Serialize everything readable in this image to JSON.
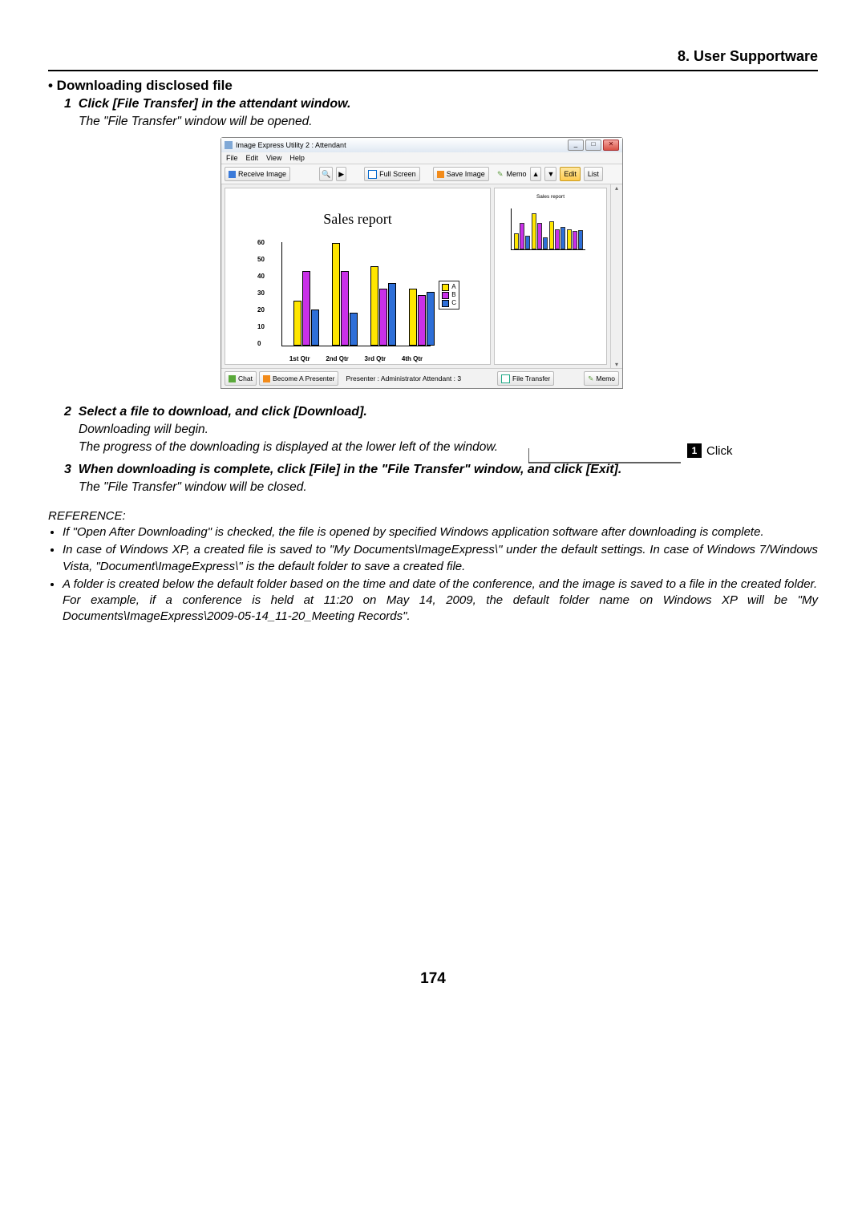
{
  "header": {
    "chapter": "8. User Supportware"
  },
  "section": {
    "title": "• Downloading disclosed file"
  },
  "steps": {
    "s1": {
      "num": "1",
      "text": "Click [File Transfer] in the attendant window.",
      "desc": "The \"File Transfer\" window will be opened."
    },
    "s2": {
      "num": "2",
      "text": "Select a file to download, and click [Download].",
      "desc1": "Downloading will begin.",
      "desc2": "The progress of the downloading is displayed at the lower left of the window."
    },
    "s3": {
      "num": "3",
      "text": "When downloading is complete, click [File] in the \"File Transfer\" window, and click [Exit].",
      "desc": "The \"File Transfer\" window will be closed."
    }
  },
  "reference": {
    "head": "REFERENCE:",
    "items": [
      "If \"Open After Downloading\" is checked, the file is opened by specified Windows application software after downloading is complete.",
      "In case of Windows XP, a created file is saved to \"My Documents\\ImageExpress\\\" under the default settings. In case of Windows 7/Windows Vista, \"Document\\ImageExpress\\\" is the default folder to save a created file.",
      "A folder is created below the default folder based on the time and date of the conference, and the image is saved to a file in the created folder.\nFor example, if a conference is held at 11:20 on May 14, 2009, the default folder name on Windows XP will be \"My Documents\\ImageExpress\\2009-05-14_11-20_Meeting Records\"."
    ]
  },
  "page_number": "174",
  "callout": {
    "label": "Click",
    "badge": "1"
  },
  "app_window": {
    "title": "Image Express Utility 2 : Attendant",
    "menus": [
      "File",
      "Edit",
      "View",
      "Help"
    ],
    "toolbar": {
      "receive": "Receive Image",
      "fullscreen": "Full Screen",
      "saveimage": "Save Image"
    },
    "side_toolbar": {
      "memo": "Memo",
      "edit": "Edit",
      "list": "List"
    },
    "status": {
      "chat": "Chat",
      "become": "Become A Presenter",
      "info": "Presenter : Administrator   Attendant : 3",
      "filetransfer": "File Transfer",
      "memo": "Memo"
    }
  },
  "chart_data": {
    "type": "bar",
    "title": "Sales report",
    "xlabel": "",
    "ylabel": "",
    "categories": [
      "1st Qtr",
      "2nd Qtr",
      "3rd Qtr",
      "4th Qtr"
    ],
    "series": [
      {
        "name": "A",
        "color": "#ffe600",
        "values": [
          25,
          58,
          45,
          32
        ]
      },
      {
        "name": "B",
        "color": "#c930e8",
        "values": [
          42,
          42,
          32,
          28
        ]
      },
      {
        "name": "C",
        "color": "#2e6fd8",
        "values": [
          20,
          18,
          35,
          30
        ]
      }
    ],
    "y_ticks": [
      0,
      10,
      20,
      30,
      40,
      50,
      60
    ],
    "ylim": [
      0,
      60
    ]
  }
}
